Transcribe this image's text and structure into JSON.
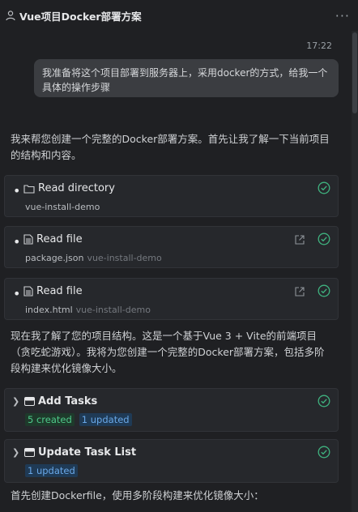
{
  "header": {
    "title": "Vue项目Docker部署方案",
    "more_label": "···"
  },
  "user_message": {
    "time": "17:22",
    "text": "我准备将这个项目部署到服务器上，采用docker的方式，给我一个具体的操作步骤"
  },
  "assistant": {
    "intro": "我来帮您创建一个完整的Docker部署方案。首先让我了解一下当前项目的结构和内容。",
    "tools": [
      {
        "icon": "folder-icon",
        "label": "Read directory",
        "file": "vue-install-demo",
        "dir": ""
      },
      {
        "icon": "file-icon",
        "label": "Read file",
        "file": "package.json",
        "dir": "vue-install-demo"
      },
      {
        "icon": "file-icon",
        "label": "Read file",
        "file": "index.html",
        "dir": "vue-install-demo"
      }
    ],
    "summary": "现在我了解了您的项目结构。这是一个基于Vue 3 + Vite的前端项目（贪吃蛇游戏）。我将为您创建一个完整的Docker部署方案，包括多阶段构建来优化镜像大小。",
    "tasks": [
      {
        "icon": "tasks-icon",
        "label": "Add Tasks",
        "badges": [
          {
            "text": "5 created",
            "color": "#4fc98a"
          },
          {
            "text": "1 updated",
            "color": "#69a8e8"
          }
        ]
      },
      {
        "icon": "task-list-icon",
        "label": "Update Task List",
        "badges": [
          {
            "text": "1 updated",
            "color": "#69a8e8"
          }
        ]
      }
    ],
    "footer": "首先创建Dockerfile，使用多阶段构建来优化镜像大小："
  },
  "colors": {
    "background": "#1f2023",
    "card": "#26282c",
    "success": "#3fb27f",
    "bubble": "#3b3d41"
  }
}
